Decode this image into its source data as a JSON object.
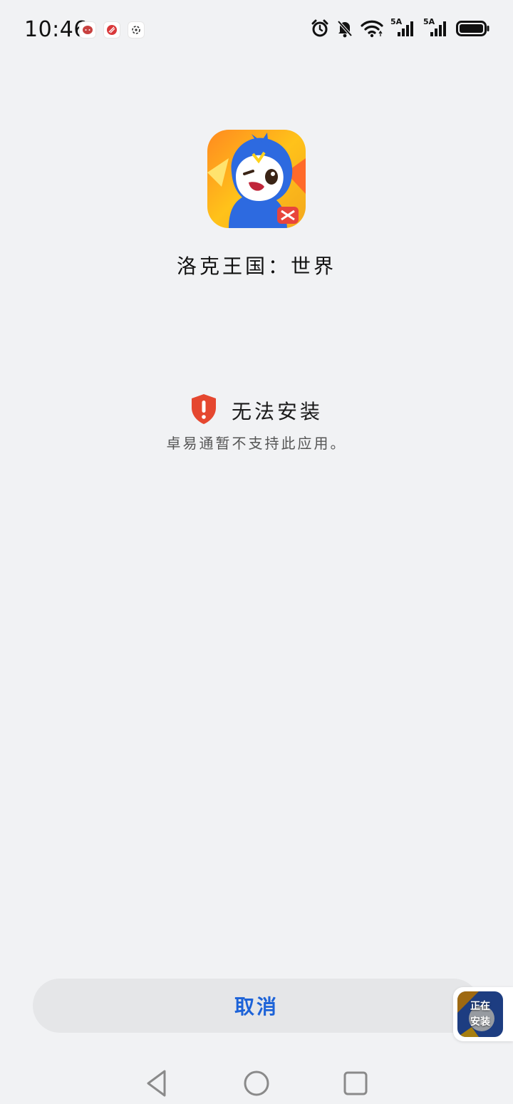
{
  "status_bar": {
    "time": "10:46",
    "notification_icons": [
      "message-app-icon",
      "browser-app-icon",
      "settings-app-icon"
    ],
    "system_icons": [
      "alarm-icon",
      "bell-muted-icon",
      "wifi-icon",
      "signal-5a-icon",
      "signal-5a-icon",
      "battery-icon"
    ],
    "signal_label_1": "5A",
    "signal_label_2": "5A"
  },
  "app": {
    "name": "洛克王国：世界",
    "icon": "app-mascot-icon"
  },
  "error": {
    "icon": "shield-alert-icon",
    "title": "无法安装",
    "description": "卓易通暂不支持此应用。",
    "color": "#e5472f"
  },
  "actions": {
    "cancel_label": "取消",
    "accent_color": "#1d63d8"
  },
  "floating_badge": {
    "line1": "正在",
    "line2": "安装"
  },
  "nav_bar": {
    "buttons": [
      "back-icon",
      "home-icon",
      "recents-icon"
    ]
  }
}
